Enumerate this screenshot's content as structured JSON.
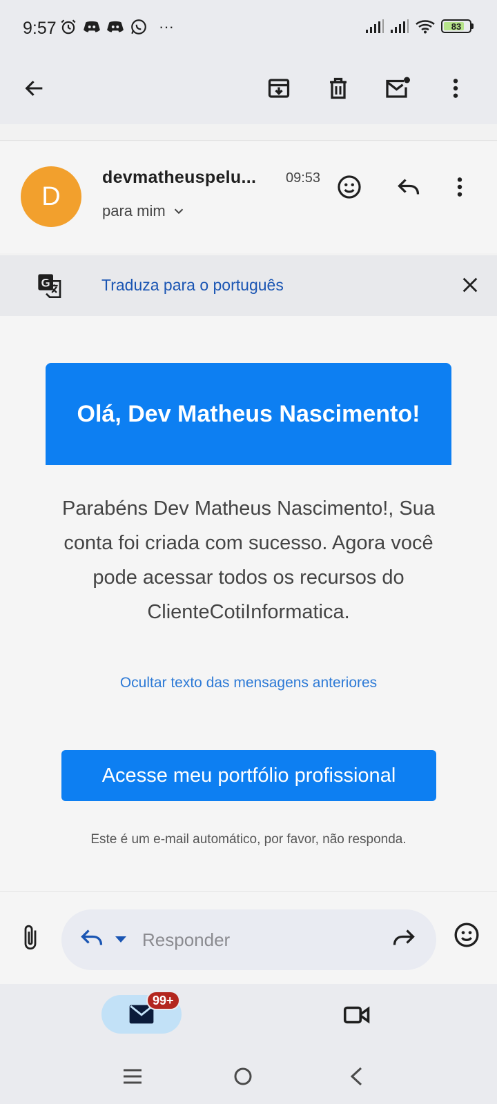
{
  "status_bar": {
    "time": "9:57",
    "battery": "83",
    "battery_level": 0.83,
    "more": "···"
  },
  "toolbar": {
    "icons": [
      "back-arrow-icon",
      "archive-icon",
      "delete-icon",
      "mark-unread-icon",
      "more-vert-icon"
    ]
  },
  "email": {
    "avatar_letter": "D",
    "avatar_color": "#f2a02d",
    "sender": "devmatheuspelu...",
    "time": "09:53",
    "recipient": "para mim"
  },
  "translate": {
    "link": "Traduza para o português"
  },
  "body": {
    "hero_title": "Olá, Dev Matheus Nascimento!",
    "message": "Parabéns Dev Matheus Nascimento!, Sua conta foi criada com sucesso. Agora você pode acessar todos os recursos do ClienteCotiInformatica.",
    "hide_link": "Ocultar texto das mensagens anteriores",
    "cta": "Acesse meu portfólio profissional",
    "auto_note": "Este é um e-mail automático, por favor, não responda."
  },
  "reply": {
    "placeholder": "Responder"
  },
  "bottom_nav": {
    "badge": "99+"
  },
  "colors": {
    "accent": "#0d7ff2",
    "link": "#1a55b3",
    "badge": "#b3261e"
  }
}
